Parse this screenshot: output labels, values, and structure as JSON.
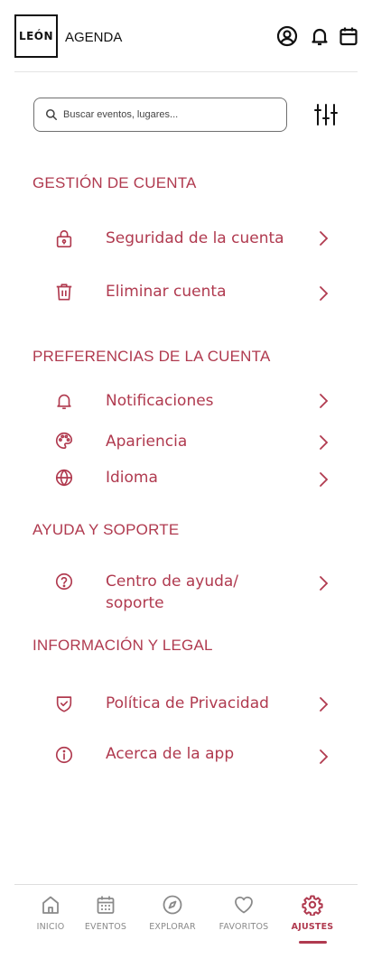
{
  "colors": {
    "accent": "#b03a4f",
    "text_dark": "#111111",
    "nav_inactive": "#8a8a8a",
    "divider": "#e4e4e4"
  },
  "header": {
    "logo": "LEÓN",
    "title": "AGENDA",
    "icons": [
      "user-circle-icon",
      "bell-icon",
      "calendar-icon"
    ]
  },
  "search": {
    "placeholder": "Buscar eventos, lugares...",
    "value": ""
  },
  "sections": {
    "cuenta": {
      "title": "GESTIÓN DE CUENTA",
      "items": [
        {
          "label": "Seguridad de la cuenta",
          "icon": "lock-icon"
        },
        {
          "label": "Eliminar cuenta",
          "icon": "trash-icon"
        }
      ]
    },
    "preferencias": {
      "title": "PREFERENCIAS DE LA CUENTA",
      "items": [
        {
          "label": "Notificaciones",
          "icon": "bell-icon"
        },
        {
          "label": "Apariencia",
          "icon": "palette-icon"
        },
        {
          "label": "Idioma",
          "icon": "globe-icon"
        }
      ]
    },
    "ayuda": {
      "title": "AYUDA Y SOPORTE",
      "items": [
        {
          "label": "Centro de ayuda/ soporte",
          "icon": "help-circle-icon"
        }
      ]
    },
    "legal": {
      "title": "INFORMACIÓN Y LEGAL",
      "items": [
        {
          "label": "Política de Privacidad",
          "icon": "shield-check-icon"
        },
        {
          "label": "Acerca de la app",
          "icon": "info-icon"
        }
      ]
    }
  },
  "nav": {
    "items": [
      {
        "label": "INICIO",
        "icon": "home-icon"
      },
      {
        "label": "EVENTOS",
        "icon": "calendar-icon"
      },
      {
        "label": "EXPLORAR",
        "icon": "compass-icon"
      },
      {
        "label": "FAVORITOS",
        "icon": "heart-icon"
      },
      {
        "label": "AJUSTES",
        "icon": "gear-icon"
      }
    ],
    "active": "AJUSTES"
  }
}
